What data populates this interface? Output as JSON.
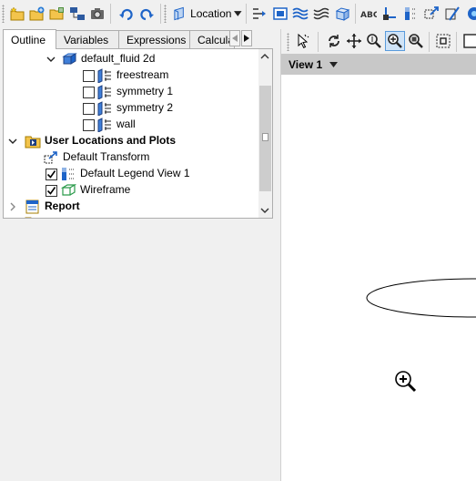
{
  "toolbar": {
    "location_label": "Location"
  },
  "tabs": [
    {
      "label": "Outline",
      "active": true
    },
    {
      "label": "Variables",
      "active": false
    },
    {
      "label": "Expressions",
      "active": false
    },
    {
      "label": "Calcula",
      "active": false
    }
  ],
  "tree": {
    "domain": "default_fluid 2d",
    "boundaries": [
      "freestream",
      "symmetry 1",
      "symmetry 2",
      "wall"
    ],
    "user_locations": "User Locations and Plots",
    "default_transform": "Default Transform",
    "legend": "Default Legend View 1",
    "wireframe": "Wireframe",
    "report": "Report"
  },
  "viewer": {
    "view_label": "View 1"
  },
  "colors": {
    "accent_blue": "#1e64c8",
    "view_header": "#c8c8c8"
  }
}
